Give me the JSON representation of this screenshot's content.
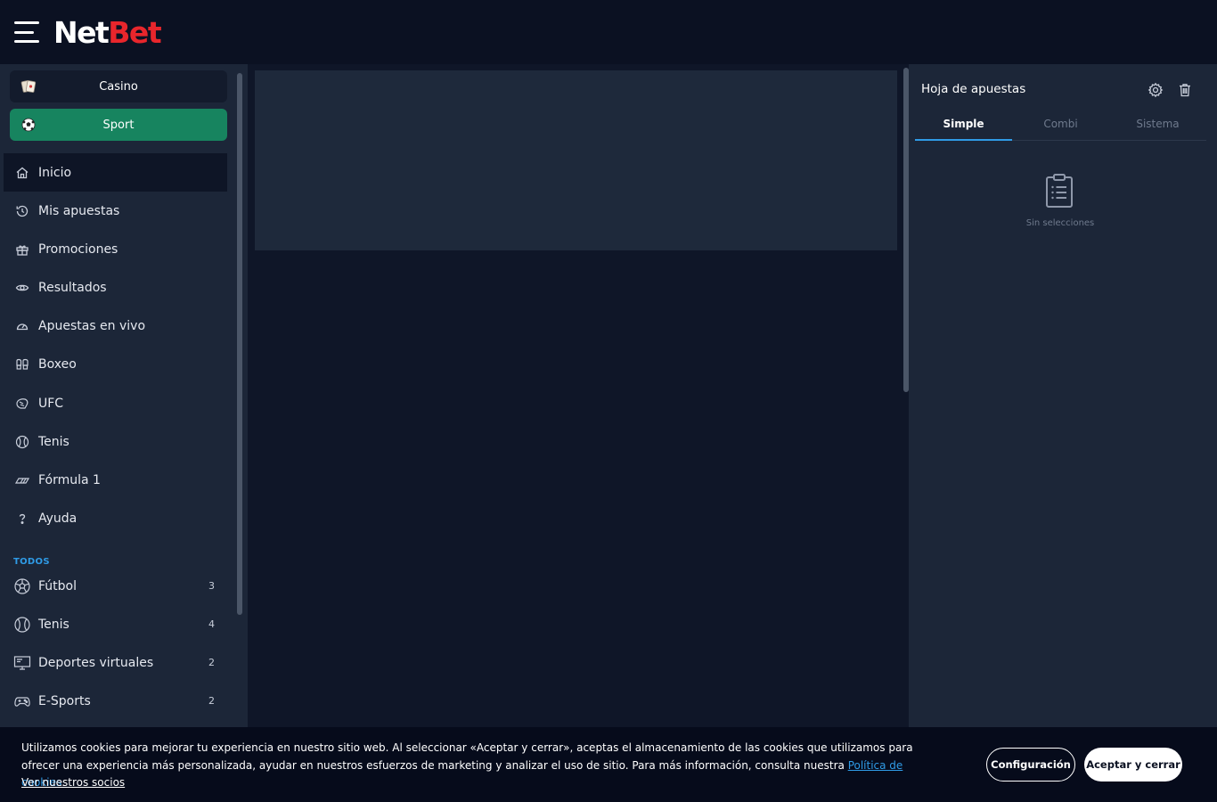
{
  "header": {
    "logo_part1": "Net",
    "logo_part2": "Bet",
    "logo_colors": {
      "net": "#ffffff",
      "bet": "#e8262c"
    }
  },
  "sidebar": {
    "verticals": [
      {
        "label": "Casino",
        "icon": "cards-icon"
      },
      {
        "label": "Sport",
        "icon": "soccer-ball-icon",
        "active": true
      }
    ],
    "nav": [
      {
        "label": "Inicio",
        "icon": "home-icon",
        "active": true
      },
      {
        "label": "Mis apuestas",
        "icon": "history-icon"
      },
      {
        "label": "Promociones",
        "icon": "gift-icon"
      },
      {
        "label": "Resultados",
        "icon": "eye-icon"
      },
      {
        "label": "Apuestas en vivo",
        "icon": "live-gauge-icon"
      },
      {
        "label": "Boxeo",
        "icon": "boxing-gloves-icon"
      },
      {
        "label": "UFC",
        "icon": "ufc-glove-icon"
      },
      {
        "label": "Tenis",
        "icon": "tennis-ball-icon"
      },
      {
        "label": "Fórmula 1",
        "icon": "f1-car-icon"
      },
      {
        "label": "Ayuda",
        "icon": "help-icon"
      }
    ],
    "section_title": "TODOS",
    "sports": [
      {
        "label": "Fútbol",
        "count": "3",
        "icon": "soccer-ball-icon"
      },
      {
        "label": "Tenis",
        "count": "4",
        "icon": "tennis-ball-icon"
      },
      {
        "label": "Deportes virtuales",
        "count": "2",
        "icon": "monitor-icon"
      },
      {
        "label": "E-Sports",
        "count": "2",
        "icon": "gamepad-icon"
      }
    ]
  },
  "betslip": {
    "title": "Hoja de apuestas",
    "tabs": [
      {
        "label": "Simple",
        "active": true
      },
      {
        "label": "Combi"
      },
      {
        "label": "Sistema"
      }
    ],
    "empty_text": "Sin selecciones"
  },
  "cookie": {
    "text_before_link": "Utilizamos cookies para mejorar tu experiencia en nuestro sitio web. Al seleccionar «Aceptar y cerrar», aceptas el almacenamiento de las cookies que utilizamos para ofrecer una experiencia más personalizada, ayudar en nuestros esfuerzos de marketing y analizar el uso de sitio. Para más información, consulta nuestra ",
    "link_label": "Política de cookies",
    "text_after_link": ".",
    "partners_link": "Ver nuestros socios",
    "config_button": "Configuración",
    "accept_button": "Aceptar y cerrar"
  },
  "colors": {
    "accent": "#2f9be6",
    "sport_active": "#17845f",
    "sidebar_bg": "#1c2638",
    "page_bg": "#0f1628"
  }
}
